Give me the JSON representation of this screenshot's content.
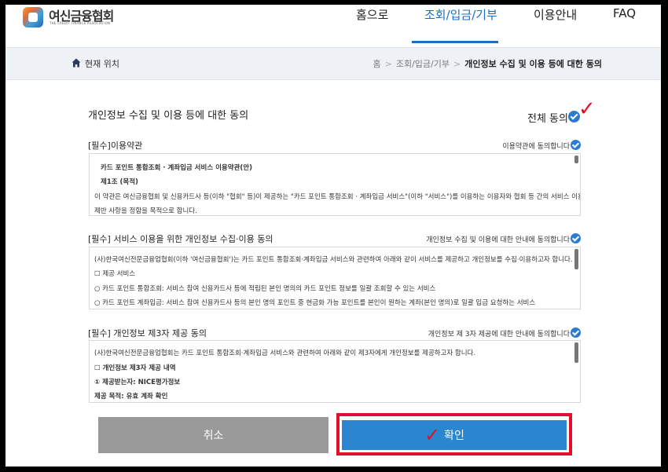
{
  "header": {
    "logo_text": "여신금융협회",
    "logo_sub": "THE CREDIT FINANCE ASSOCIATION",
    "nav": [
      "홈으로",
      "조회/입금/기부",
      "이용안내",
      "FAQ"
    ],
    "active_nav": 1
  },
  "breadcrumb": {
    "label": "현재 위치",
    "items": [
      "홈",
      "조회/입금/기부",
      "개인정보 수집 및 이용 등에 대한 동의"
    ]
  },
  "page": {
    "title": "개인정보 수집 및 이용 등에 대한 동의",
    "agree_all_label": "전체 동의",
    "agree_all_checked": true
  },
  "sections": [
    {
      "title": "[필수]이용약관",
      "agree_label": "이용약관에 동의합니다",
      "checked": true,
      "lines": [
        {
          "text": "카드 포인트 통합조회 · 계좌입금 서비스 이용약관(안)",
          "bold": true
        },
        {
          "text": "제1조 (목적)",
          "bold": true
        },
        {
          "text": "이 약관은 여신금융협회 및 신용카드사 등(이하 \"협회\" 등)이 제공하는 \"카드 포인트 통합조회 · 계좌입금 서비스\"(이하 \"서비스\")를 이용하는 이용자와 협회 등 간의 서비스 이용에 관한",
          "bold": false
        },
        {
          "text": "제반 사항을 정함을 목적으로 합니다.",
          "bold": false
        }
      ]
    },
    {
      "title": "[필수] 서비스 이용을 위한 개인정보 수집·이용 동의",
      "agree_label": "개인정보 수집 및 이용에 대한 안내에 동의합니다",
      "checked": true,
      "lines": [
        {
          "text": "(사)한국여신전문금융업협회(이하 '여신금융협회')는 카드 포인트 통합조회·계좌입금 서비스와 관련하여 아래와 같이 서비스를 제공하고 개인정보를 수집·이용하고자 합니다.",
          "bold": false
        },
        {
          "text": "☐ 제공 서비스",
          "bold": false
        },
        {
          "text": "○ 카드 포인트 통합조회: 서비스 참여 신용카드사 등에 적립된 본인 명의의 카드 포인트 정보를 일괄 조회할 수 있는 서비스",
          "bold": false
        },
        {
          "text": "○ 카드 포인트 계좌입금: 서비스 참여 신용카드사 등의 본인 명의 포인트 중 현금화 가능 포인트를 본인이 원하는 계좌(본인 명의)로 일괄 입금 요청하는 서비스",
          "bold": false
        }
      ]
    },
    {
      "title": "[필수] 개인정보 제3자 제공 동의",
      "agree_label": "개인정보 제 3자 제공에 대한 안내에 동의합니다",
      "checked": true,
      "lines": [
        {
          "text": "(사)한국여신전문금융업협회는 카드 포인트 통합조회·계좌입금 서비스와 관련하여 아래와 같이 제3자에게 개인정보를 제공하고자 합니다.",
          "bold": false
        },
        {
          "text": "☐ 개인정보 제3자 제공 내역",
          "bold": true
        },
        {
          "text": "① 제공받는자: NICE평가정보",
          "bold": true
        },
        {
          "text": "제공 목적: 유효 계좌 확인",
          "bold": true
        }
      ]
    }
  ],
  "buttons": {
    "cancel": "취소",
    "confirm": "확인"
  },
  "colors": {
    "accent": "#2b86cf",
    "highlight": "#e0102a",
    "cancel": "#999999"
  }
}
